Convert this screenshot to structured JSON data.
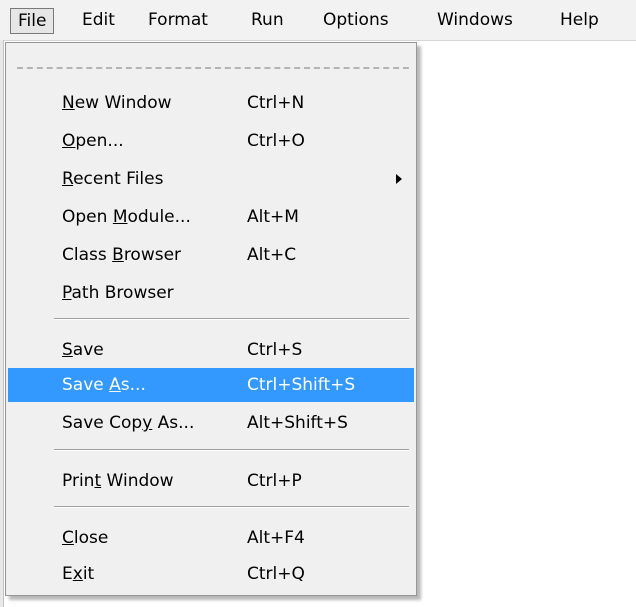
{
  "menubar": {
    "items": [
      "File",
      "Edit",
      "Format",
      "Run",
      "Options",
      "Windows",
      "Help"
    ]
  },
  "file_menu": {
    "groups": [
      [
        {
          "pre": "",
          "u": "N",
          "post": "ew Window",
          "shortcut": "Ctrl+N"
        },
        {
          "pre": "",
          "u": "O",
          "post": "pen...",
          "shortcut": "Ctrl+O"
        },
        {
          "pre": "",
          "u": "R",
          "post": "ecent Files",
          "shortcut": "",
          "submenu": true
        },
        {
          "pre": "Open ",
          "u": "M",
          "post": "odule...",
          "shortcut": "Alt+M"
        },
        {
          "pre": "Class ",
          "u": "B",
          "post": "rowser",
          "shortcut": "Alt+C"
        },
        {
          "pre": "",
          "u": "P",
          "post": "ath Browser",
          "shortcut": ""
        }
      ],
      [
        {
          "pre": "",
          "u": "S",
          "post": "ave",
          "shortcut": "Ctrl+S"
        },
        {
          "pre": "Save ",
          "u": "A",
          "post": "s...",
          "shortcut": "Ctrl+Shift+S",
          "selected": true
        },
        {
          "pre": "Save Cop",
          "u": "y",
          "post": " As...",
          "shortcut": "Alt+Shift+S"
        }
      ],
      [
        {
          "pre": "Prin",
          "u": "t",
          "post": " Window",
          "shortcut": "Ctrl+P"
        }
      ],
      [
        {
          "pre": "",
          "u": "C",
          "post": "lose",
          "shortcut": "Alt+F4"
        },
        {
          "pre": "E",
          "u": "x",
          "post": "it",
          "shortcut": "Ctrl+Q"
        }
      ]
    ]
  }
}
